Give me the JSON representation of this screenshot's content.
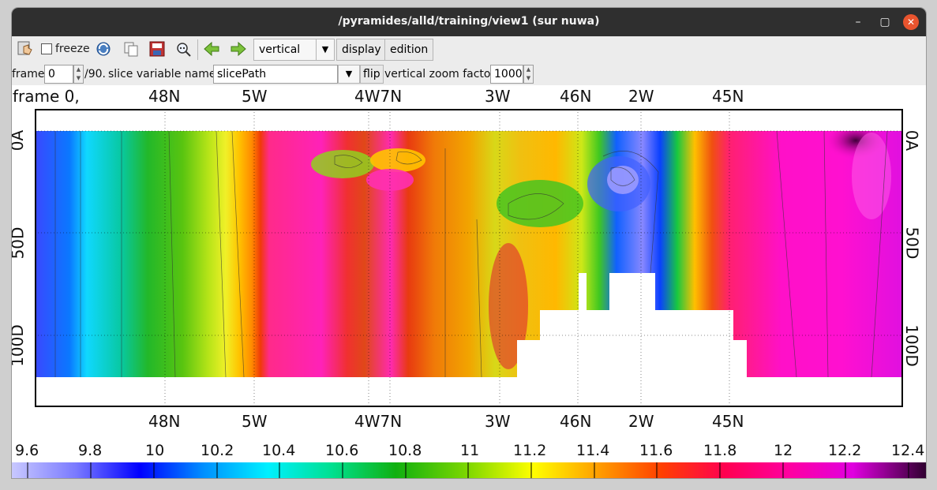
{
  "window": {
    "title": "/pyramides/alld/training/view1 (sur nuwa)"
  },
  "toolbar": {
    "freeze_label": "freeze",
    "orientation_value": "vertical",
    "display_label": "display",
    "edition_label": "edition"
  },
  "controls": {
    "frame_label": "frame",
    "frame_value": "0",
    "frame_total": "/90.",
    "slice_var_label": "slice variable name :",
    "slice_var_value": "slicePath",
    "flip_label": "flip",
    "zoom_label": "vertical zoom factor:",
    "zoom_value": "1000"
  },
  "plot": {
    "frame_title": "frame 0,",
    "x_ticks": [
      "48N",
      "5W",
      "4W7N",
      "3W",
      "46N",
      "2W",
      "45N"
    ],
    "y_ticks": [
      "0A",
      "50D",
      "100D"
    ]
  },
  "colorbar": {
    "ticks": [
      "9.6",
      "9.8",
      "10",
      "10.2",
      "10.4",
      "10.6",
      "10.8",
      "11",
      "11.2",
      "11.4",
      "11.6",
      "11.8",
      "12",
      "12.2",
      "12.4"
    ]
  }
}
